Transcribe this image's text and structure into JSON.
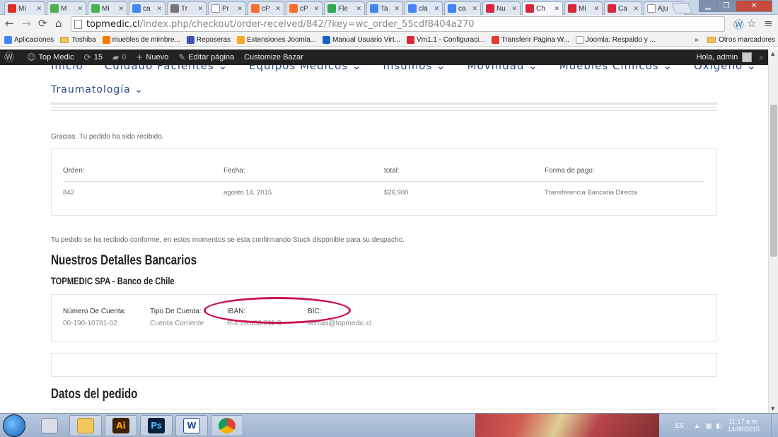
{
  "browser": {
    "tabs": [
      {
        "label": "Mi",
        "icon": "gmail-icon",
        "color": "#d93025"
      },
      {
        "label": "M",
        "icon": "page-icon",
        "color": "#4caf50"
      },
      {
        "label": "Mi",
        "icon": "page-icon",
        "color": "#4caf50"
      },
      {
        "label": "ca",
        "icon": "google-icon",
        "color": "#4285f4"
      },
      {
        "label": "Tr",
        "icon": "page-icon",
        "color": "#777777"
      },
      {
        "label": "Pr",
        "icon": "blank-page-icon",
        "color": "#ffffff"
      },
      {
        "label": "cP",
        "icon": "cpanel-icon",
        "color": "#ff6c2c"
      },
      {
        "label": "cP",
        "icon": "cpanel-icon",
        "color": "#ff6c2c"
      },
      {
        "label": "Fle",
        "icon": "drive-icon",
        "color": "#34a853"
      },
      {
        "label": "Ta",
        "icon": "docs-icon",
        "color": "#4285f4"
      },
      {
        "label": "cla",
        "icon": "docs-icon",
        "color": "#4285f4"
      },
      {
        "label": "ca",
        "icon": "google-icon",
        "color": "#4285f4"
      },
      {
        "label": "Nu",
        "icon": "w-icon",
        "color": "#d7263d"
      },
      {
        "label": "Ch",
        "icon": "tm-icon",
        "color": "#d7263d"
      },
      {
        "label": "Mi",
        "icon": "w-icon",
        "color": "#d7263d"
      },
      {
        "label": "Ca",
        "icon": "w-icon",
        "color": "#d7263d"
      },
      {
        "label": "Aju",
        "icon": "blank-page-icon",
        "color": "#ffffff"
      }
    ],
    "active_tab_index": 13,
    "url_host": "topmedic.cl",
    "url_path": "/index.php/checkout/order-received/842/?key=wc_order_55cdf8404a270",
    "bookmarks": [
      {
        "label": "Aplicaciones",
        "icon": "apps-icon"
      },
      {
        "label": "Toshiba",
        "icon": "folder-icon"
      },
      {
        "label": "muebles de mimbre...",
        "icon": "b-icon"
      },
      {
        "label": "Reposeras",
        "icon": "page-icon"
      },
      {
        "label": "Extensiones Joomla...",
        "icon": "joomla-icon"
      },
      {
        "label": "Manual Usuario Virt...",
        "icon": "book-icon"
      },
      {
        "label": "Vm1.1 - Configuraci...",
        "icon": "w-icon"
      },
      {
        "label": "Transferir Pagina W...",
        "icon": "youtube-icon"
      },
      {
        "label": "Joomla: Respaldo y ...",
        "icon": "blank-page-icon"
      }
    ],
    "more_bookmarks": "»",
    "other_bookmarks": "Otros marcadores"
  },
  "adminbar": {
    "site_name": "Top Medic",
    "updates": "15",
    "comments": "0",
    "new": "Nuevo",
    "edit": "Editar página",
    "customize": "Customize Bazar",
    "greeting": "Hola, admin"
  },
  "site_menu": {
    "items": [
      "Inicio",
      "Cuidado Pacientes ⌄",
      "Equipos Médicos ⌄",
      "Insumos ⌄",
      "Movilidad ⌄",
      "Muebles Clínicos ⌄",
      "Oxígeno ⌄"
    ],
    "second_row": "Traumatología ⌄"
  },
  "order": {
    "thanks": "Gracias. Tu pedido ha sido recibido.",
    "headers": [
      "Orden:",
      "Fecha:",
      "total:",
      "Forma de pago:"
    ],
    "values": [
      "842",
      "agosto 14, 2015",
      "$26.900",
      "Transferencia Bancaria Directa"
    ],
    "confirm_note": "Tu pedido se ha recibido conforme, en estos momentos se esta confirmando Stock disponible para su despacho."
  },
  "bank": {
    "title": "Nuestros Detalles Bancarios",
    "subtitle": "TOPMEDIC SPA - Banco de Chile",
    "labels": [
      "Número De Cuenta:",
      "Tipo De Cuenta:",
      "IBAN:",
      "BIC:"
    ],
    "values": [
      "00-190-10781-02",
      "Cuenta Corriente",
      "Rut 76.400.211-3",
      "ventas@topmedic.cl"
    ],
    "highlight_color": "#c8154f"
  },
  "details": {
    "title": "Datos del pedido"
  },
  "taskbar": {
    "lang": "ES",
    "time": "11:17 a.m.",
    "date": "14/08/2015",
    "apps": [
      "explorer",
      "Ai",
      "Ps",
      "W",
      "chrome"
    ]
  }
}
